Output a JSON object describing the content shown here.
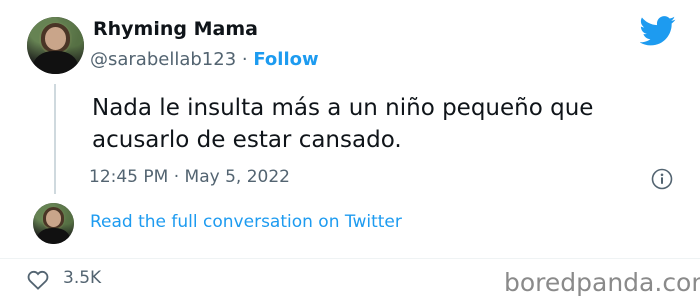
{
  "tweet": {
    "author_name": "Rhyming Mama",
    "handle": "@sarabellab123",
    "separator": "·",
    "follow_label": "Follow",
    "text": "Nada le insulta más a un niño pequeño que acusarlo de estar cansado.",
    "timestamp": "12:45 PM · May 5, 2022",
    "read_full_label": "Read the full conversation on Twitter",
    "likes": "3.5K"
  },
  "watermark": "boredpanda.com",
  "icons": {
    "brand": "twitter-bird-icon",
    "info": "info-icon",
    "like": "heart-icon"
  },
  "colors": {
    "accent": "#1d9bf0",
    "text_primary": "#0f1419",
    "text_secondary": "#536471"
  }
}
